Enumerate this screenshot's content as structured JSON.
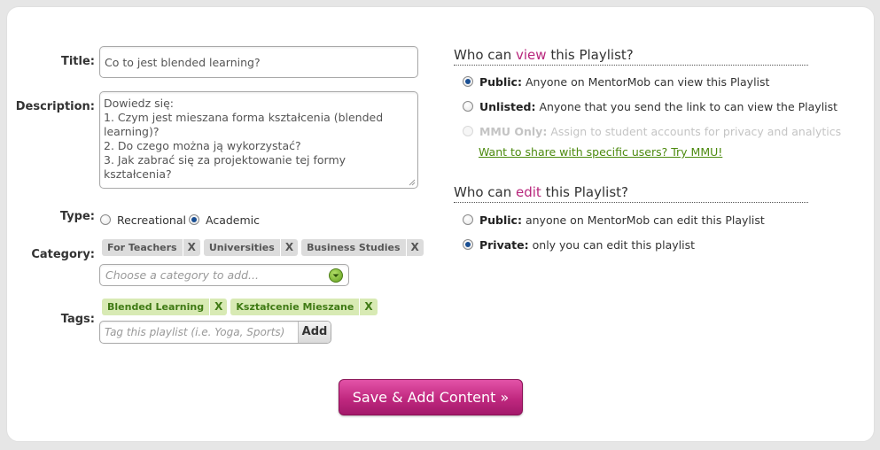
{
  "form": {
    "title_label": "Title:",
    "title_value": "Co to jest blended learning?",
    "description_label": "Description:",
    "description_lines": [
      "Dowiedz się:",
      "1. Czym jest mieszana forma kształcenia (blended",
      "learning)?",
      "2. Do czego można ją wykorzystać?",
      "3. Jak zabrać się za projektowanie tej formy kształcenia?"
    ],
    "type_label": "Type:",
    "type_options": [
      "Recreational",
      "Academic"
    ],
    "type_selected": "Academic",
    "category_label": "Category:",
    "categories": [
      "For Teachers",
      "Universities",
      "Business Studies"
    ],
    "category_placeholder": "Choose a category to add...",
    "tags_label": "Tags:",
    "tags": [
      "Blended Learning",
      "Kształcenie Mieszane"
    ],
    "tag_placeholder": "Tag this playlist (i.e. Yoga, Sports)",
    "add_label": "Add",
    "chip_remove": "X"
  },
  "view": {
    "heading_pre": "Who can ",
    "heading_accent": "view",
    "heading_post": " this Playlist?",
    "options": [
      {
        "bold": "Public:",
        "text": "Anyone on MentorMob can view this Playlist",
        "selected": true,
        "disabled": false
      },
      {
        "bold": "Unlisted:",
        "text": "Anyone that you send the link to can view the Playlist",
        "selected": false,
        "disabled": false
      },
      {
        "bold": "MMU Only:",
        "text": "Assign to student accounts for privacy and analytics",
        "selected": false,
        "disabled": true
      }
    ],
    "mmu_link": "Want to share with specific users? Try MMU!"
  },
  "edit": {
    "heading_pre": "Who can ",
    "heading_accent": "edit",
    "heading_post": " this Playlist?",
    "options": [
      {
        "bold": "Public:",
        "text": "anyone on MentorMob can edit this Playlist",
        "selected": false
      },
      {
        "bold": "Private:",
        "text": "only you can edit this playlist",
        "selected": true
      }
    ]
  },
  "save_label": "Save & Add Content »",
  "colors": {
    "accent": "#b8267c",
    "link_green": "#4c8a0e",
    "button_pink": "#c0287f"
  }
}
